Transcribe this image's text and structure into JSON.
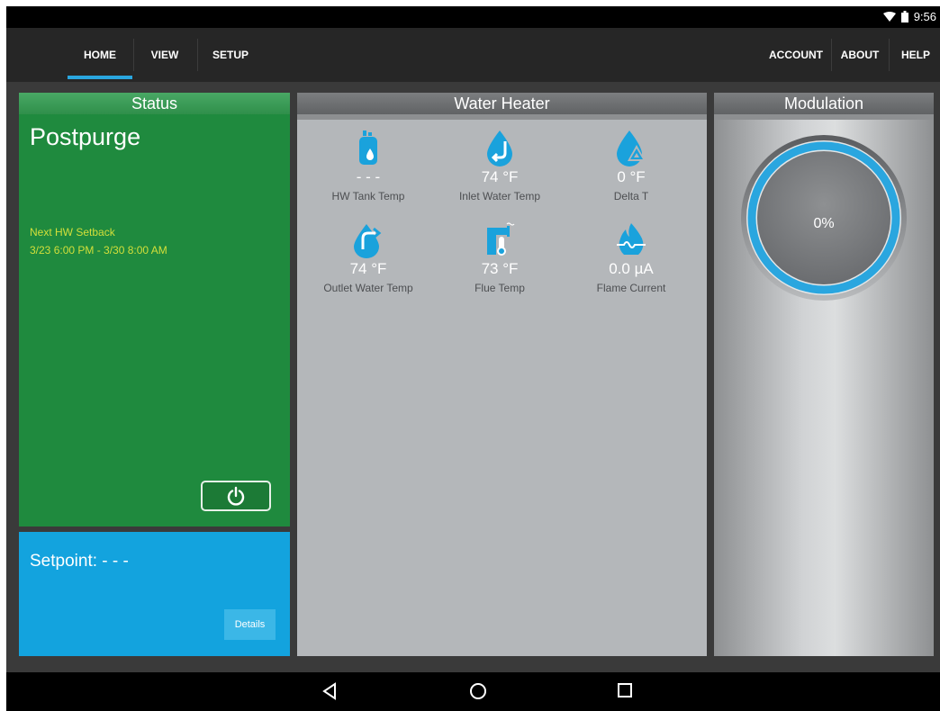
{
  "status_bar": {
    "time": "9:56"
  },
  "nav": {
    "left_tabs": [
      "HOME",
      "VIEW",
      "SETUP"
    ],
    "right_tabs": [
      "ACCOUNT",
      "ABOUT",
      "HELP"
    ],
    "active": "HOME"
  },
  "status_panel": {
    "title": "Status",
    "state": "Postpurge",
    "setback_label": "Next HW Setback",
    "setback_range": "3/23 6:00 PM - 3/30 8:00 AM",
    "power_icon": "power-icon"
  },
  "setpoint_panel": {
    "label": "Setpoint: - - -",
    "details": "Details"
  },
  "water_heater": {
    "title": "Water Heater",
    "tiles": [
      {
        "icon": "tank-icon",
        "value": "- - -",
        "label": "HW Tank Temp"
      },
      {
        "icon": "inlet-water-icon",
        "value": "74 °F",
        "label": "Inlet Water Temp"
      },
      {
        "icon": "delta-t-icon",
        "value": "0 °F",
        "label": "Delta T"
      },
      {
        "icon": "outlet-water-icon",
        "value": "74 °F",
        "label": "Outlet Water Temp"
      },
      {
        "icon": "flue-temp-icon",
        "value": "73 °F",
        "label": "Flue Temp"
      },
      {
        "icon": "flame-current-icon",
        "value": "0.0 µA",
        "label": "Flame Current"
      }
    ]
  },
  "modulation": {
    "title": "Modulation",
    "value": "0%",
    "level": 0
  },
  "colors": {
    "status_green": "#1f8a3e",
    "setpoint_blue": "#13a3de",
    "accent": "#2aa6df",
    "setback_text": "#d3df3a"
  }
}
